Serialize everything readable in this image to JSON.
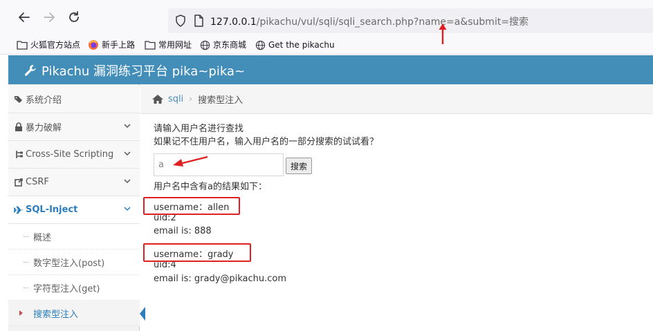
{
  "browser": {
    "url_host": "127.0.0.1",
    "url_path": "/pikachu/vul/sqli/sqli_search.php?name=a&submit=搜索"
  },
  "bookmarks": [
    {
      "label": "火狐官方站点",
      "icon": "folder-icon"
    },
    {
      "label": "新手上路",
      "icon": "firefox-icon"
    },
    {
      "label": "常用网址",
      "icon": "folder-icon"
    },
    {
      "label": "京东商城",
      "icon": "globe-icon"
    },
    {
      "label": "Get the pikachu",
      "icon": "globe-icon"
    }
  ],
  "header": {
    "title": "Pikachu 漏洞练习平台 pika~pika~",
    "icon": "wrench-icon"
  },
  "sidebar": {
    "items": [
      {
        "label": "系统介绍",
        "icon": "tags-icon"
      },
      {
        "label": "暴力破解",
        "icon": "lock-icon"
      },
      {
        "label": "Cross-Site Scripting",
        "icon": "sitemap-icon"
      },
      {
        "label": "CSRF",
        "icon": "share-icon"
      },
      {
        "label": "SQL-Inject",
        "icon": "plane-icon"
      }
    ],
    "subitems": [
      {
        "label": "概述"
      },
      {
        "label": "数字型注入(post)"
      },
      {
        "label": "字符型注入(get)"
      },
      {
        "label": "搜索型注入"
      }
    ]
  },
  "breadcrumb": {
    "link": "sqli",
    "current": "搜索型注入",
    "icon": "home-icon"
  },
  "content": {
    "prompt_line1": "请输入用户名进行查找",
    "prompt_line2": "如果记不住用户名，输入用户名的一部分搜索的试试看？",
    "input_value": "a",
    "search_button": "搜索",
    "result_heading": "用户名中含有a的结果如下：",
    "results": [
      {
        "username": "username：allen",
        "uid": "uid:2",
        "email": "email is: 888"
      },
      {
        "username": "username：grady",
        "uid": "uid:4",
        "email": "email is: grady@pikachu.com"
      }
    ]
  },
  "colors": {
    "header": "#438eb9",
    "active": "#2b7dbc",
    "annotation": "#e02020"
  }
}
